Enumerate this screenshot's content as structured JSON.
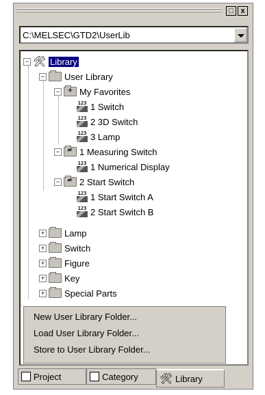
{
  "window": {
    "min_glyph": "□",
    "close_glyph": "x"
  },
  "path_combo": {
    "value": "C:\\MELSEC\\GTD2\\UserLib"
  },
  "tree": {
    "root": "Library",
    "user_library": "User Library",
    "my_favorites": "My Favorites",
    "fav_items": [
      "1 Switch",
      "2 3D Switch",
      "3 Lamp"
    ],
    "measuring": "1 Measuring Switch",
    "measuring_items": [
      "1 Numerical Display"
    ],
    "start": "2 Start Switch",
    "start_items": [
      "1 Start Switch A",
      "2 Start Switch B"
    ],
    "folders": [
      "Lamp",
      "Switch",
      "Figure",
      "Key",
      "Special Parts"
    ]
  },
  "context_menu": {
    "items": [
      "New User Library Folder...",
      "Load User Library Folder...",
      "Store to User Library Folder..."
    ]
  },
  "tabs": {
    "project": "Project",
    "category": "Category",
    "library": "Library"
  },
  "icons": {
    "tools": "🛠",
    "part_digits": "123"
  }
}
